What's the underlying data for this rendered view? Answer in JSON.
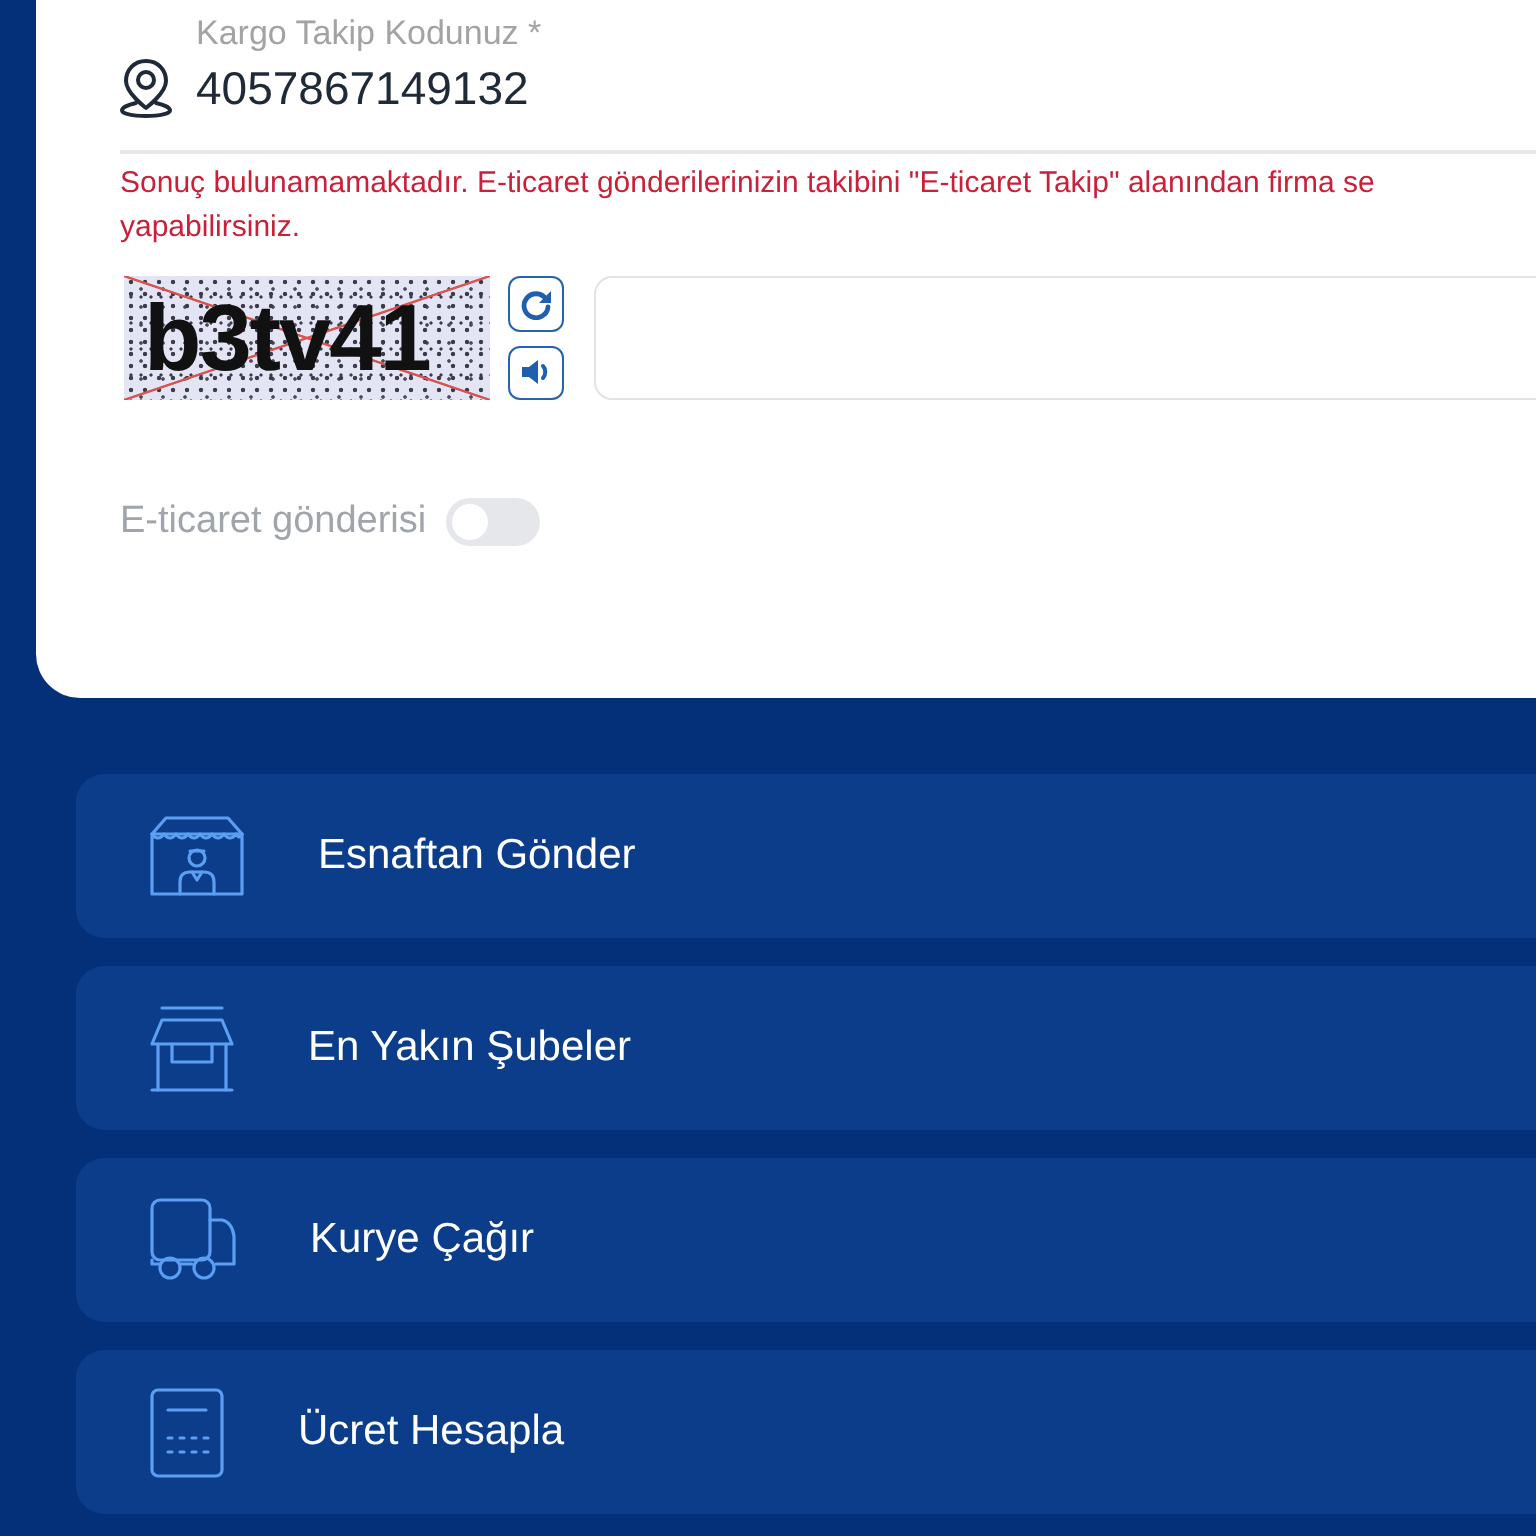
{
  "tracking_form": {
    "tracking_code_field": {
      "label": "Kargo Takip Kodunuz *",
      "value": "4057867149132"
    },
    "error_message": {
      "lines": [
        "Sonuç bulunamamaktadır. E-ticaret gönderilerinizin takibini \"E-ticaret Takip\" alanından firma se",
        "yapabilirsiniz."
      ]
    },
    "captcha": {
      "text": "b3tv41"
    },
    "ecommerce_toggle": {
      "label": "E-ticaret gönderisi",
      "on": false
    }
  },
  "menu": {
    "items": [
      {
        "label": "Esnaftan Gönder"
      },
      {
        "label": "En Yakın Şubeler"
      },
      {
        "label": "Kurye Çağır"
      },
      {
        "label": "Ücret Hesapla"
      }
    ]
  }
}
